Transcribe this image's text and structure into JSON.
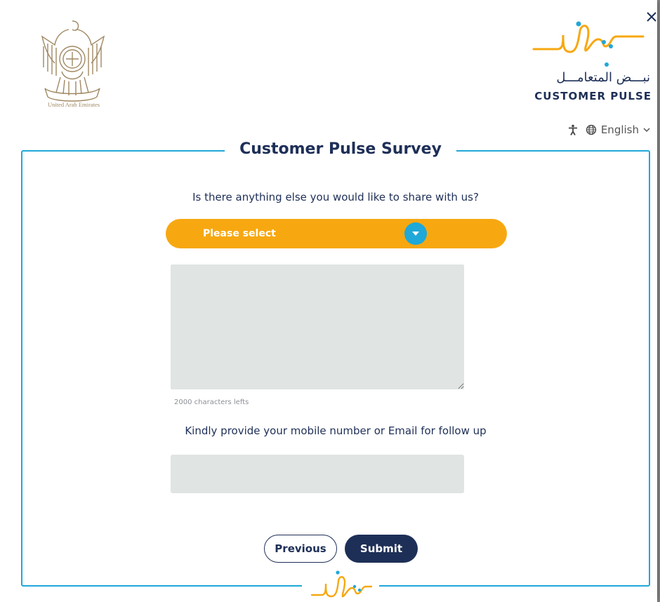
{
  "header": {
    "uae_caption": "United Arab Emirates",
    "brand_arabic": "نبـــض المتعامـــل",
    "brand_english": "CUSTOMER PULSE",
    "language": "English"
  },
  "survey": {
    "title": "Customer Pulse Survey",
    "question1": "Is there anything else you would like to share with us?",
    "select_placeholder": "Please select",
    "textarea_value": "",
    "chars_left": "2000 characters lefts",
    "question2": "Kindly provide your mobile number or Email for follow up",
    "contact_value": ""
  },
  "buttons": {
    "previous": "Previous",
    "submit": "Submit"
  },
  "colors": {
    "navy": "#1e2f57",
    "accent_blue": "#1fa8d8",
    "accent_orange": "#f7a811",
    "field_gray": "#e0e4e3"
  },
  "icons": {
    "close": "close-icon",
    "accessibility": "accessibility-icon",
    "globe": "globe-icon",
    "chevron": "chevron-down-icon",
    "select_caret": "caret-down-icon"
  }
}
